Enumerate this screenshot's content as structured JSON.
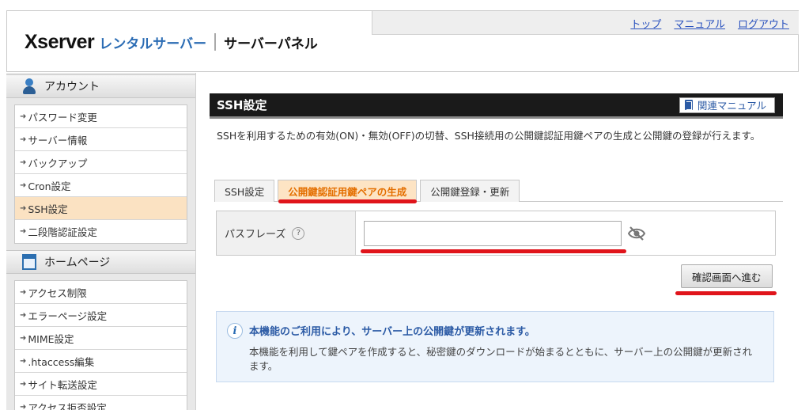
{
  "header": {
    "brand": "Xserver",
    "subtitle": "レンタルサーバー",
    "panel": "サーバーパネル",
    "links": [
      "トップ",
      "マニュアル",
      "ログアウト"
    ]
  },
  "sidebar": {
    "sections": [
      {
        "title": "アカウント",
        "icon": "person-icon",
        "items": [
          "パスワード変更",
          "サーバー情報",
          "バックアップ",
          "Cron設定",
          "SSH設定",
          "二段階認証設定"
        ],
        "active": "SSH設定"
      },
      {
        "title": "ホームページ",
        "icon": "homepage-icon",
        "items": [
          "アクセス制限",
          "エラーページ設定",
          "MIME設定",
          ".htaccess編集",
          "サイト転送設定",
          "アクセス拒否設定"
        ]
      }
    ]
  },
  "main": {
    "title": "SSH設定",
    "manual_button": "関連マニュアル",
    "description": "SSHを利用するための有効(ON)・無効(OFF)の切替、SSH接続用の公開鍵認証用鍵ペアの生成と公開鍵の登録が行えます。",
    "tabs": [
      {
        "label": "SSH設定",
        "active": false
      },
      {
        "label": "公開鍵認証用鍵ペアの生成",
        "active": true
      },
      {
        "label": "公開鍵登録・更新",
        "active": false
      }
    ],
    "form": {
      "label": "パスフレーズ",
      "help": "?",
      "value": ""
    },
    "confirm_button": "確認画面へ進む",
    "info": {
      "title": "本機能のご利用により、サーバー上の公開鍵が更新されます。",
      "body": "本機能を利用して鍵ペアを作成すると、秘密鍵のダウンロードが始まるとともに、サーバー上の公開鍵が更新されます。"
    }
  },
  "colors": {
    "title_bar": "#1a1a1a",
    "active_tab_text": "#e46f00",
    "active_tab_bg": "#fde4c4",
    "active_side_item": "#fbe2c2",
    "link": "#2a52be",
    "annotation": "#e0141b"
  }
}
